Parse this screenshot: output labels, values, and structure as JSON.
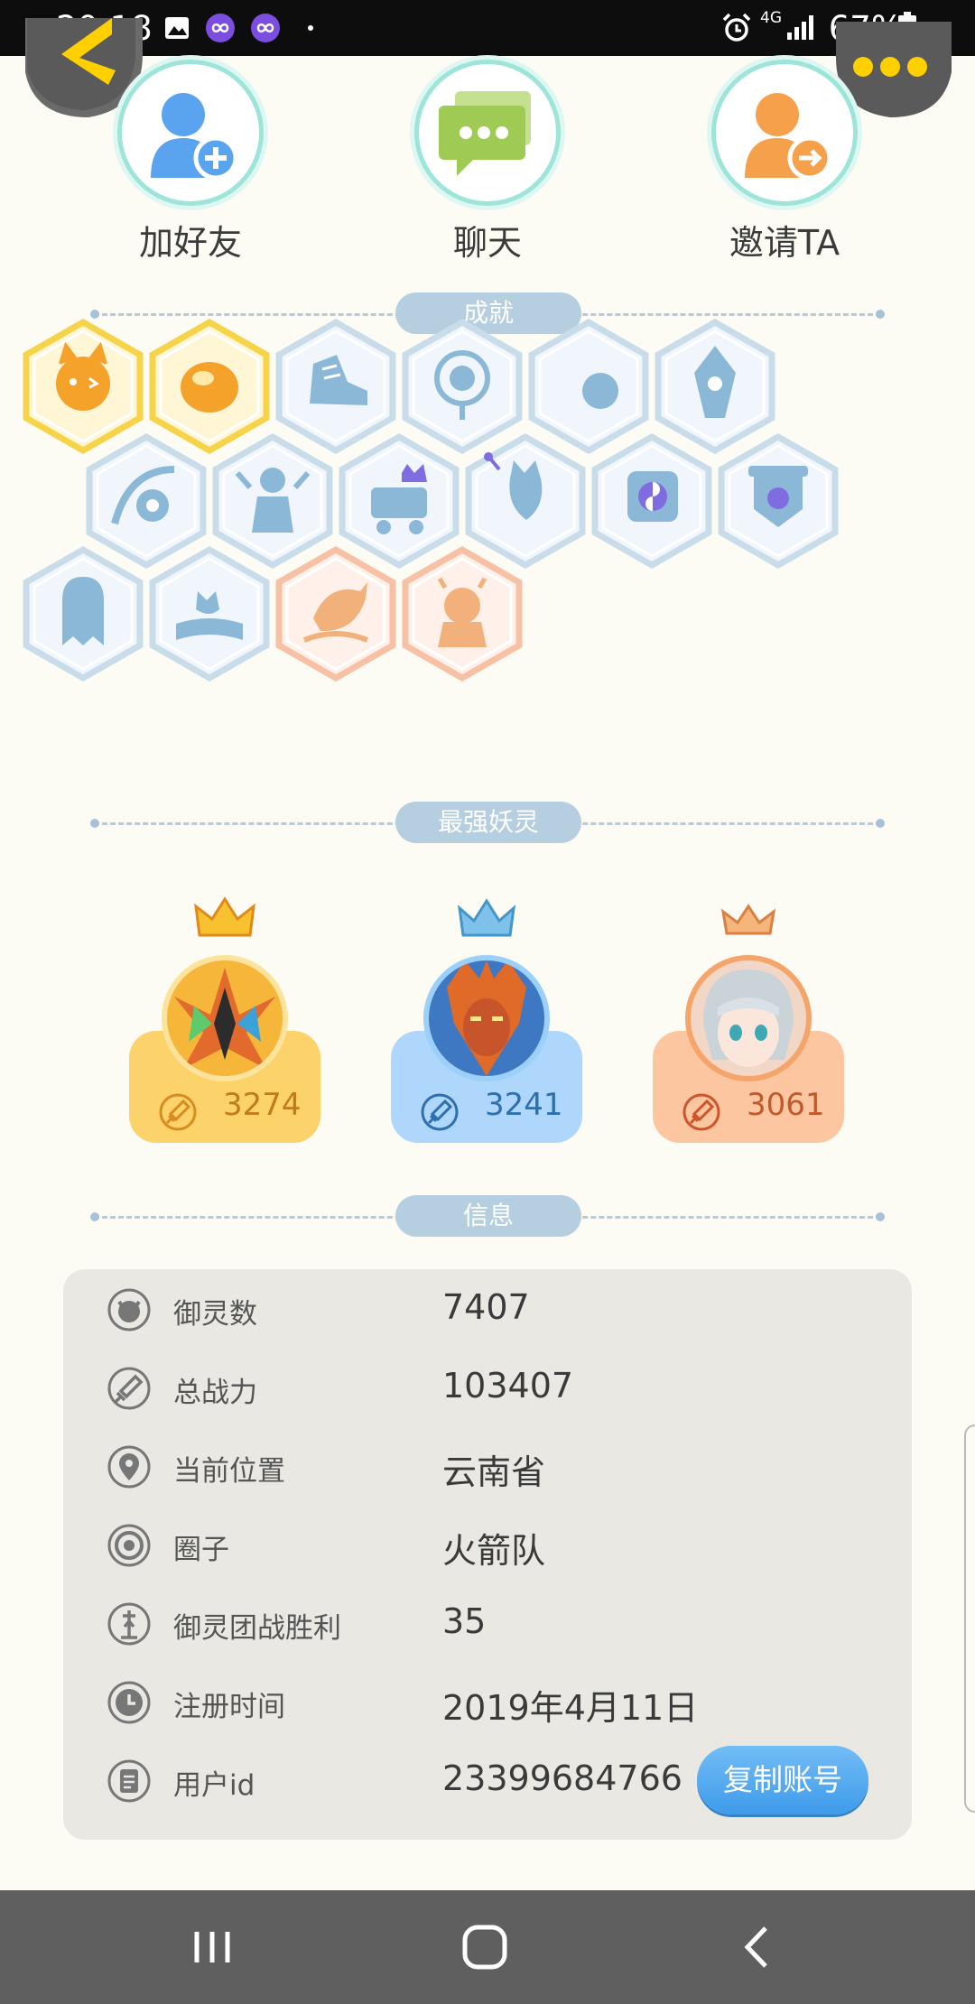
{
  "status_bar": {
    "time": "20:18",
    "network": "4G",
    "battery": "67%",
    "left_icons": [
      "image-icon",
      "infinity-icon",
      "infinity-icon",
      "dot-icon"
    ],
    "right_icons": [
      "alarm-icon",
      "signal-icon",
      "battery-icon"
    ]
  },
  "header": {
    "back_icon": "back-arrow-icon",
    "more_icon": "more-dots-icon"
  },
  "actions": [
    {
      "label": "加好友",
      "icon": "add-friend-icon",
      "color": "#5aa3ef"
    },
    {
      "label": "聊天",
      "icon": "chat-icon",
      "color": "#9fcb55"
    },
    {
      "label": "邀请TA",
      "icon": "invite-icon",
      "color": "#f5a04a"
    }
  ],
  "sections": {
    "achievements": "成就",
    "top_spirits": "最强妖灵",
    "info": "信息"
  },
  "achievements": [
    {
      "icon": "fox-face-badge-icon",
      "unlocked": true
    },
    {
      "icon": "gold-bun-badge-icon",
      "unlocked": true
    },
    {
      "icon": "sneaker-badge-icon",
      "unlocked": false
    },
    {
      "icon": "portal-badge-icon",
      "unlocked": false
    },
    {
      "icon": "moon-badge-icon",
      "unlocked": false
    },
    {
      "icon": "crystal-badge-icon",
      "unlocked": false
    },
    {
      "icon": "yin-yang-wave-badge-icon",
      "unlocked": false
    },
    {
      "icon": "spirit-statue-badge-icon",
      "unlocked": false
    },
    {
      "icon": "cat-cart-badge-icon",
      "unlocked": false
    },
    {
      "icon": "cat-wand-badge-icon",
      "unlocked": false
    },
    {
      "icon": "yin-yang-cube-badge-icon",
      "unlocked": false
    },
    {
      "icon": "shield-scroll-badge-icon",
      "unlocked": false
    },
    {
      "icon": "ghost-badge-icon",
      "unlocked": false
    },
    {
      "icon": "cat-book-badge-icon",
      "unlocked": false
    },
    {
      "icon": "fish-badge-icon",
      "unlocked": "special"
    },
    {
      "icon": "lion-badge-icon",
      "unlocked": "special"
    }
  ],
  "top_spirits": [
    {
      "power": "3274",
      "crown": "gold",
      "card_color": "#fcd36b",
      "text_color": "#c07c18"
    },
    {
      "power": "3241",
      "crown": "silver",
      "card_color": "#aed7fb",
      "text_color": "#2e6fae"
    },
    {
      "power": "3061",
      "crown": "bronze",
      "card_color": "#fbc6a0",
      "text_color": "#c05a2d"
    }
  ],
  "info": {
    "rows": [
      {
        "icon": "spirit-count-icon",
        "key": "御灵数",
        "value": "7407"
      },
      {
        "icon": "sword-icon",
        "key": "总战力",
        "value": "103407"
      },
      {
        "icon": "location-pin-icon",
        "key": "当前位置",
        "value": "云南省"
      },
      {
        "icon": "circle-group-icon",
        "key": "圈子",
        "value": "火箭队"
      },
      {
        "icon": "team-battle-icon",
        "key": "御灵团战胜利",
        "value": "35"
      },
      {
        "icon": "clock-icon",
        "key": "注册时间",
        "value": "2019年4月11日"
      },
      {
        "icon": "user-id-icon",
        "key": "用户id",
        "value": "23399684766"
      }
    ],
    "copy_button": "复制账号"
  },
  "nav": {
    "icons": [
      "recent-apps-icon",
      "home-icon",
      "back-icon"
    ]
  }
}
